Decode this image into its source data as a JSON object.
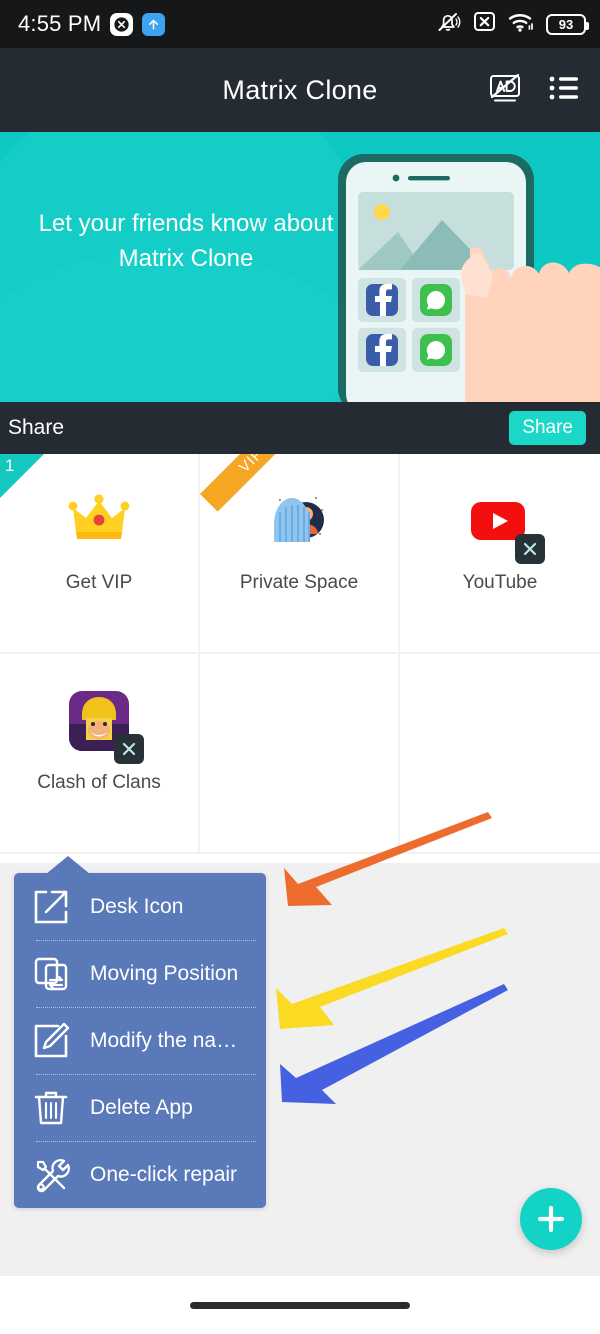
{
  "status_bar": {
    "time": "4:55 PM",
    "left_icons": [
      "x-circle-icon",
      "upload-arrow-icon"
    ],
    "right_icons": [
      "bell-muted-icon",
      "sim-card-off-icon",
      "wifi-icon"
    ],
    "battery_level": "93"
  },
  "app_bar": {
    "title": "Matrix Clone",
    "actions": [
      {
        "name": "no-ads-icon"
      },
      {
        "name": "list-menu-icon"
      }
    ]
  },
  "banner": {
    "headline": "Let your friends know about Matrix Clone",
    "background_color": "#0ec9c3"
  },
  "share_bar": {
    "label": "Share",
    "button_label": "Share",
    "button_color": "#1ad7c8",
    "bar_color": "#252b33"
  },
  "apps": [
    {
      "name": "Get VIP",
      "icon": "crown-icon",
      "badge": "1",
      "badge_type": "count",
      "badge_color": "#12c8bf",
      "deletable": false
    },
    {
      "name": "Private Space",
      "icon": "private-space-icon",
      "badge": "VIP",
      "badge_type": "vip",
      "badge_color": "#f5a623",
      "deletable": false
    },
    {
      "name": "YouTube",
      "icon": "youtube-icon",
      "badge": "",
      "badge_type": "none",
      "badge_color": "",
      "deletable": true
    },
    {
      "name": "Clash of Clans",
      "icon": "clash-of-clans-icon",
      "badge": "",
      "badge_type": "none",
      "badge_color": "",
      "deletable": true
    }
  ],
  "context_menu": {
    "items": [
      {
        "label": "Desk Icon",
        "icon": "external-link-icon"
      },
      {
        "label": "Moving Position",
        "icon": "move-copy-icon"
      },
      {
        "label": "Modify the na…",
        "icon": "edit-pencil-icon"
      },
      {
        "label": "Delete App",
        "icon": "trash-icon"
      },
      {
        "label": "One-click repair",
        "icon": "wrench-screwdriver-icon"
      }
    ],
    "background_color": "#5a79b8"
  },
  "annotations": [
    {
      "name": "orange-arrow",
      "color": "#ed6b2d"
    },
    {
      "name": "yellow-arrow",
      "color": "#fada23"
    },
    {
      "name": "blue-arrow",
      "color": "#4560e0"
    }
  ],
  "fab": {
    "name": "add-app-button",
    "icon": "plus-icon",
    "color": "#12d3c6"
  },
  "nav_bar": {
    "name": "gesture-pill"
  }
}
